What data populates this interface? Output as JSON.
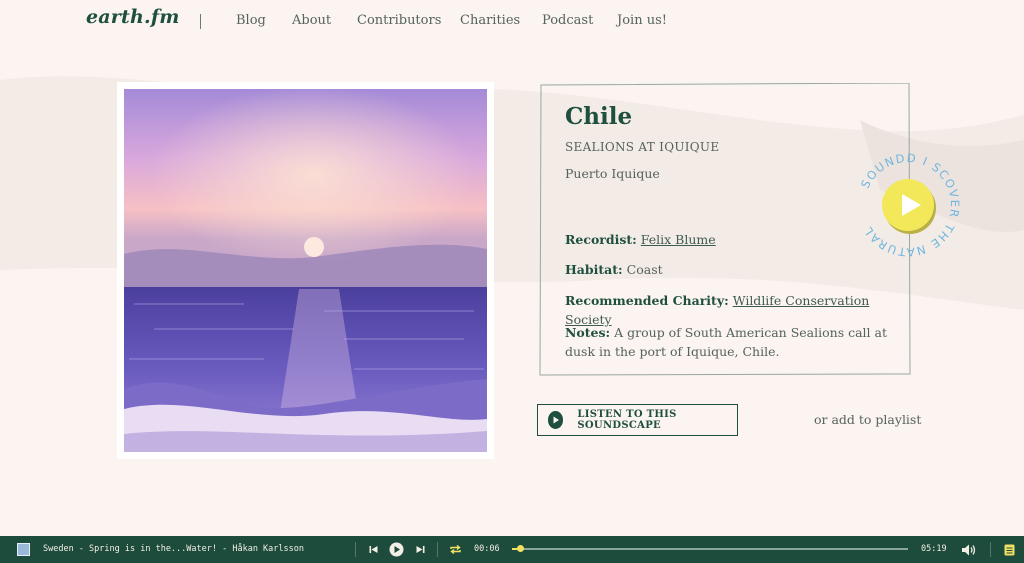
{
  "brand": {
    "logo": "earth.fm"
  },
  "nav": {
    "items": [
      "Blog",
      "About",
      "Contributors",
      "Charities",
      "Podcast",
      "Join us!"
    ]
  },
  "sound": {
    "title": "Chile",
    "subtitle": "SEALIONS AT IQUIQUE",
    "location": "Puerto Iquique",
    "recordist_label": "Recordist:",
    "recordist": "Felix Blume",
    "habitat_label": "Habitat:",
    "habitat": "Coast",
    "charity_label": "Recommended Charity:",
    "charity": "Wildlife Conservation Society",
    "notes_label": "Notes:",
    "notes": "A group of South American Sealions call at dusk in the port of Iquique, Chile."
  },
  "badge": {
    "text": "SOUNDD I SCOVER THE NATURAL"
  },
  "actions": {
    "listen_label": "LISTEN TO THIS SOUNDSCAPE",
    "playlist_label": "or add to playlist"
  },
  "player": {
    "track": "Sweden - Spring is in the...Water! - Håkan Karlsson",
    "elapsed": "00:06",
    "duration": "05:19",
    "progress": 0.02
  },
  "colors": {
    "brand_green": "#1e4c3c",
    "accent_yellow": "#f2e063",
    "background": "#fbf4f0"
  },
  "icons": [
    "previous-icon",
    "play-icon",
    "next-icon",
    "repeat-icon",
    "volume-icon",
    "playlist-icon"
  ]
}
